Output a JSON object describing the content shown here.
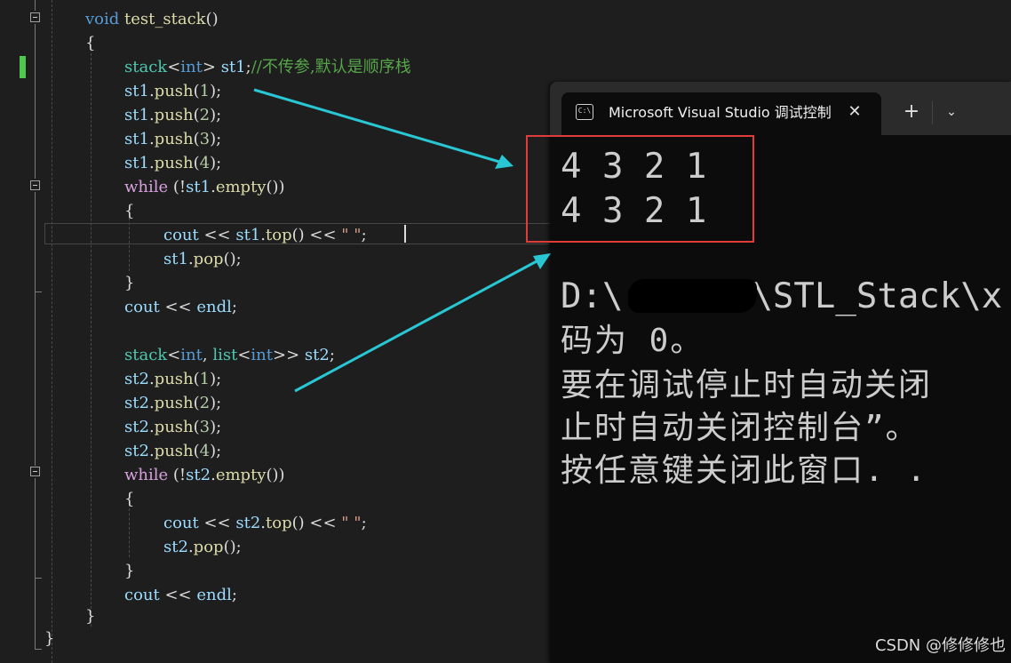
{
  "editor": {
    "lines": [
      {
        "id": "l0",
        "tokens": [
          {
            "t": "void",
            "c": "kw"
          },
          {
            "t": " ",
            "c": "txt"
          },
          {
            "t": "test_stack",
            "c": "fn"
          },
          {
            "t": "()",
            "c": "txt"
          }
        ]
      },
      {
        "id": "l1",
        "tokens": [
          {
            "t": "{",
            "c": "txt"
          }
        ]
      },
      {
        "id": "l2",
        "tokens": [
          {
            "t": "stack",
            "c": "type"
          },
          {
            "t": "<",
            "c": "txt"
          },
          {
            "t": "int",
            "c": "kw"
          },
          {
            "t": "> ",
            "c": "txt"
          },
          {
            "t": "st1",
            "c": "var"
          },
          {
            "t": ";",
            "c": "txt"
          },
          {
            "t": "//不传参,默认是顺序栈",
            "c": "cm"
          }
        ]
      },
      {
        "id": "l3",
        "tokens": [
          {
            "t": "st1",
            "c": "var"
          },
          {
            "t": ".",
            "c": "txt"
          },
          {
            "t": "push",
            "c": "fn"
          },
          {
            "t": "(",
            "c": "txt"
          },
          {
            "t": "1",
            "c": "num"
          },
          {
            "t": ");",
            "c": "txt"
          }
        ]
      },
      {
        "id": "l4",
        "tokens": [
          {
            "t": "st1",
            "c": "var"
          },
          {
            "t": ".",
            "c": "txt"
          },
          {
            "t": "push",
            "c": "fn"
          },
          {
            "t": "(",
            "c": "txt"
          },
          {
            "t": "2",
            "c": "num"
          },
          {
            "t": ");",
            "c": "txt"
          }
        ]
      },
      {
        "id": "l5",
        "tokens": [
          {
            "t": "st1",
            "c": "var"
          },
          {
            "t": ".",
            "c": "txt"
          },
          {
            "t": "push",
            "c": "fn"
          },
          {
            "t": "(",
            "c": "txt"
          },
          {
            "t": "3",
            "c": "num"
          },
          {
            "t": ");",
            "c": "txt"
          }
        ]
      },
      {
        "id": "l6",
        "tokens": [
          {
            "t": "st1",
            "c": "var"
          },
          {
            "t": ".",
            "c": "txt"
          },
          {
            "t": "push",
            "c": "fn"
          },
          {
            "t": "(",
            "c": "txt"
          },
          {
            "t": "4",
            "c": "num"
          },
          {
            "t": ");",
            "c": "txt"
          }
        ]
      },
      {
        "id": "l7",
        "tokens": [
          {
            "t": "while",
            "c": "kw-ctl"
          },
          {
            "t": " (!",
            "c": "txt"
          },
          {
            "t": "st1",
            "c": "var"
          },
          {
            "t": ".",
            "c": "txt"
          },
          {
            "t": "empty",
            "c": "fn"
          },
          {
            "t": "())",
            "c": "txt"
          }
        ]
      },
      {
        "id": "l8",
        "tokens": [
          {
            "t": "{",
            "c": "txt"
          }
        ]
      },
      {
        "id": "l9",
        "tokens": [
          {
            "t": "cout",
            "c": "var"
          },
          {
            "t": " << ",
            "c": "txt"
          },
          {
            "t": "st1",
            "c": "var"
          },
          {
            "t": ".",
            "c": "txt"
          },
          {
            "t": "top",
            "c": "fn"
          },
          {
            "t": "() << ",
            "c": "txt"
          },
          {
            "t": "\" \"",
            "c": "str"
          },
          {
            "t": ";",
            "c": "txt"
          }
        ]
      },
      {
        "id": "l10",
        "tokens": [
          {
            "t": "st1",
            "c": "var"
          },
          {
            "t": ".",
            "c": "txt"
          },
          {
            "t": "pop",
            "c": "fn"
          },
          {
            "t": "();",
            "c": "txt"
          }
        ]
      },
      {
        "id": "l11",
        "tokens": [
          {
            "t": "}",
            "c": "txt"
          }
        ]
      },
      {
        "id": "l12",
        "tokens": [
          {
            "t": "cout",
            "c": "var"
          },
          {
            "t": " << ",
            "c": "txt"
          },
          {
            "t": "endl",
            "c": "var"
          },
          {
            "t": ";",
            "c": "txt"
          }
        ]
      },
      {
        "id": "l13",
        "tokens": []
      },
      {
        "id": "l14",
        "tokens": [
          {
            "t": "stack",
            "c": "type"
          },
          {
            "t": "<",
            "c": "txt"
          },
          {
            "t": "int",
            "c": "kw"
          },
          {
            "t": ", ",
            "c": "txt"
          },
          {
            "t": "list",
            "c": "type"
          },
          {
            "t": "<",
            "c": "txt"
          },
          {
            "t": "int",
            "c": "kw"
          },
          {
            "t": ">> ",
            "c": "txt"
          },
          {
            "t": "st2",
            "c": "var"
          },
          {
            "t": ";",
            "c": "txt"
          }
        ]
      },
      {
        "id": "l15",
        "tokens": [
          {
            "t": "st2",
            "c": "var"
          },
          {
            "t": ".",
            "c": "txt"
          },
          {
            "t": "push",
            "c": "fn"
          },
          {
            "t": "(",
            "c": "txt"
          },
          {
            "t": "1",
            "c": "num"
          },
          {
            "t": ");",
            "c": "txt"
          }
        ]
      },
      {
        "id": "l16",
        "tokens": [
          {
            "t": "st2",
            "c": "var"
          },
          {
            "t": ".",
            "c": "txt"
          },
          {
            "t": "push",
            "c": "fn"
          },
          {
            "t": "(",
            "c": "txt"
          },
          {
            "t": "2",
            "c": "num"
          },
          {
            "t": ");",
            "c": "txt"
          }
        ]
      },
      {
        "id": "l17",
        "tokens": [
          {
            "t": "st2",
            "c": "var"
          },
          {
            "t": ".",
            "c": "txt"
          },
          {
            "t": "push",
            "c": "fn"
          },
          {
            "t": "(",
            "c": "txt"
          },
          {
            "t": "3",
            "c": "num"
          },
          {
            "t": ");",
            "c": "txt"
          }
        ]
      },
      {
        "id": "l18",
        "tokens": [
          {
            "t": "st2",
            "c": "var"
          },
          {
            "t": ".",
            "c": "txt"
          },
          {
            "t": "push",
            "c": "fn"
          },
          {
            "t": "(",
            "c": "txt"
          },
          {
            "t": "4",
            "c": "num"
          },
          {
            "t": ");",
            "c": "txt"
          }
        ]
      },
      {
        "id": "l19",
        "tokens": [
          {
            "t": "while",
            "c": "kw-ctl"
          },
          {
            "t": " (!",
            "c": "txt"
          },
          {
            "t": "st2",
            "c": "var"
          },
          {
            "t": ".",
            "c": "txt"
          },
          {
            "t": "empty",
            "c": "fn"
          },
          {
            "t": "())",
            "c": "txt"
          }
        ]
      },
      {
        "id": "l20",
        "tokens": [
          {
            "t": "{",
            "c": "txt"
          }
        ]
      },
      {
        "id": "l21",
        "tokens": [
          {
            "t": "cout",
            "c": "var"
          },
          {
            "t": " << ",
            "c": "txt"
          },
          {
            "t": "st2",
            "c": "var"
          },
          {
            "t": ".",
            "c": "txt"
          },
          {
            "t": "top",
            "c": "fn"
          },
          {
            "t": "() << ",
            "c": "txt"
          },
          {
            "t": "\" \"",
            "c": "str"
          },
          {
            "t": ";",
            "c": "txt"
          }
        ]
      },
      {
        "id": "l22",
        "tokens": [
          {
            "t": "st2",
            "c": "var"
          },
          {
            "t": ".",
            "c": "txt"
          },
          {
            "t": "pop",
            "c": "fn"
          },
          {
            "t": "();",
            "c": "txt"
          }
        ]
      },
      {
        "id": "l23",
        "tokens": [
          {
            "t": "}",
            "c": "txt"
          }
        ]
      },
      {
        "id": "l24",
        "tokens": [
          {
            "t": "cout",
            "c": "var"
          },
          {
            "t": " << ",
            "c": "txt"
          },
          {
            "t": "endl",
            "c": "var"
          },
          {
            "t": ";",
            "c": "txt"
          }
        ]
      },
      {
        "id": "l25",
        "tokens": [
          {
            "t": "}",
            "c": "txt"
          }
        ]
      },
      {
        "id": "l26",
        "tokens": [
          {
            "t": "}",
            "c": "txt"
          }
        ]
      }
    ]
  },
  "console": {
    "tab_title": "Microsoft Visual Studio 调试控制台",
    "tab_icon_text": "C:\\",
    "close_glyph": "✕",
    "new_tab_glyph": "+",
    "dropdown_glyph": "⌄",
    "output_lines": [
      "4 3 2 1",
      "4 3 2 1"
    ],
    "path_prefix": "D:\\",
    "path_suffix": "\\STL_Stack\\x",
    "msg_exit_code": "码为 0。",
    "msg_line1": "要在调试停止时自动关闭",
    "msg_line2": "止时自动关闭控制台”。",
    "msg_line3": "按任意键关闭此窗口. ."
  },
  "annotations": {
    "arrow_color": "#29c7d4",
    "box_color": "#e03c3c"
  },
  "watermark": "CSDN @修修修也"
}
